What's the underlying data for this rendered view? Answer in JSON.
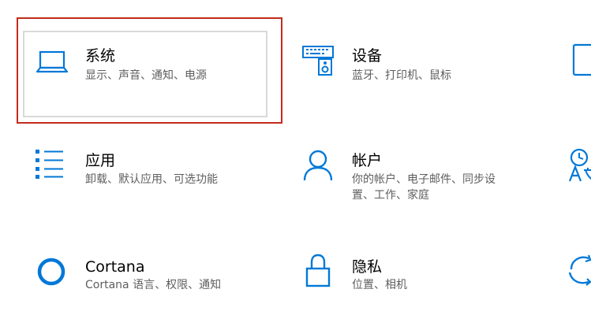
{
  "accent_color": "#0078d7",
  "highlight_color": "#c42b1c",
  "tiles": [
    {
      "title": "系统",
      "desc": "显示、声音、通知、电源",
      "icon": "laptop-icon"
    },
    {
      "title": "设备",
      "desc": "蓝牙、打印机、鼠标",
      "icon": "keyboard-speaker-icon"
    },
    {
      "title": "应用",
      "desc": "卸载、默认应用、可选功能",
      "icon": "app-list-icon"
    },
    {
      "title": "帐户",
      "desc": "你的帐户、电子邮件、同步设置、工作、家庭",
      "icon": "person-icon"
    },
    {
      "title": "Cortana",
      "desc": "Cortana 语言、权限、通知",
      "icon": "cortana-circle-icon"
    },
    {
      "title": "隐私",
      "desc": "位置、相机",
      "icon": "lock-icon"
    }
  ],
  "partial_icons": [
    "phone-icon",
    "time-language-icon",
    "update-icon"
  ]
}
